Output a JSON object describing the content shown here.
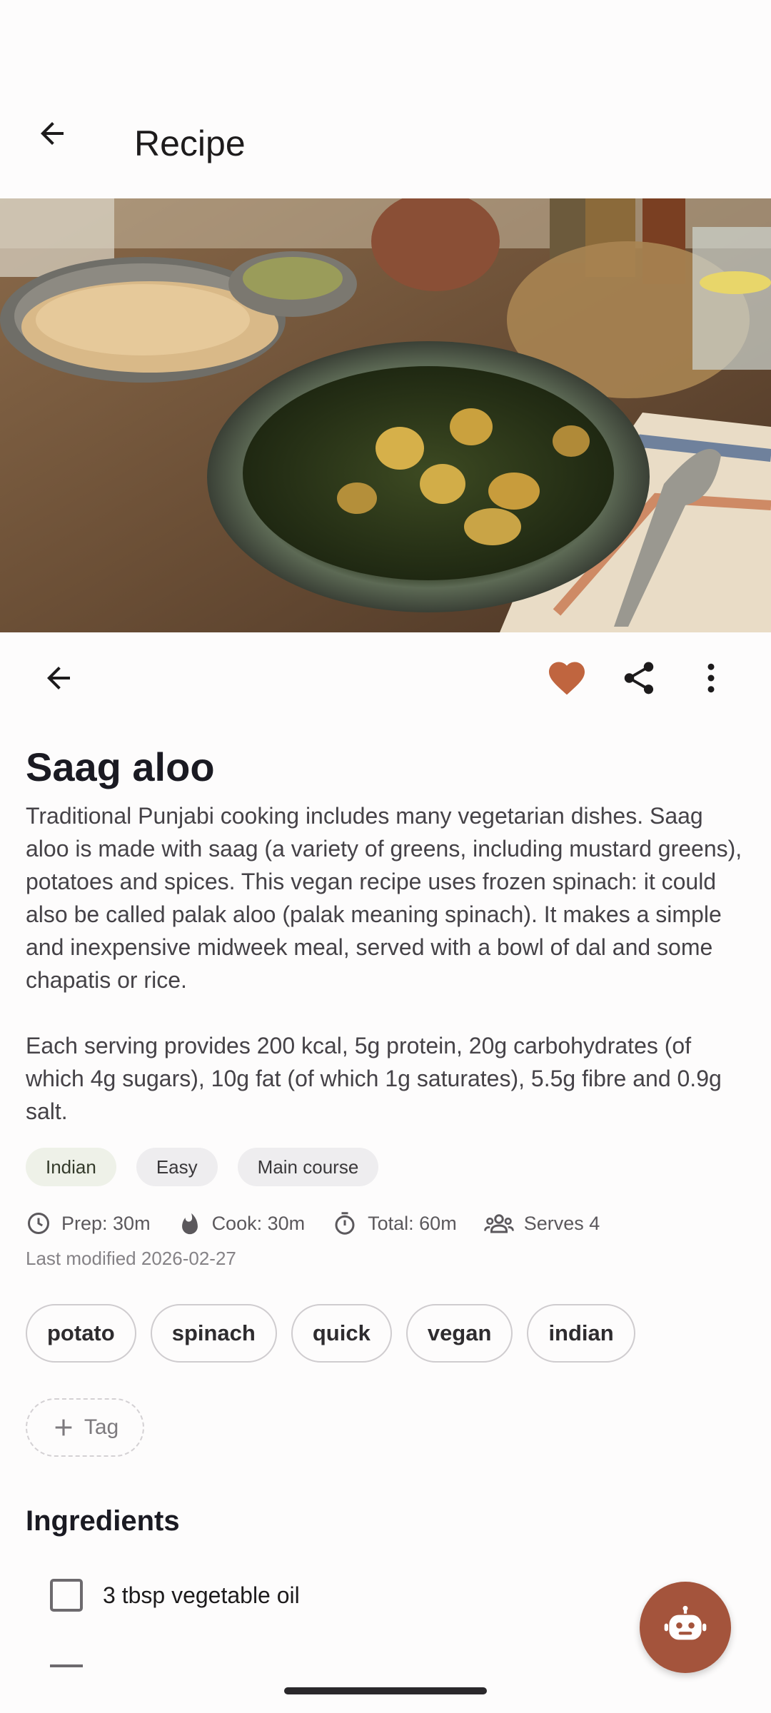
{
  "app_bar": {
    "title": "Recipe"
  },
  "hero": {
    "description_image": "saag-aloo-photo"
  },
  "actions": {
    "back_icon": "arrow-back-icon",
    "favorite_icon": "heart-icon",
    "favorite_color": "#c0653f",
    "share_icon": "share-icon",
    "more_icon": "more-vert-icon"
  },
  "recipe": {
    "title": "Saag aloo",
    "description": "Traditional Punjabi cooking includes many vegetarian dishes. Saag aloo is made with saag (a variety of greens, including mustard greens), potatoes and spices. This vegan recipe uses frozen spinach: it could also be called palak aloo (palak meaning spinach). It makes a simple and inexpensive midweek meal, served with a bowl of dal and some chapatis or rice.\n\nEach serving provides 200 kcal, 5g protein, 20g carbohydrates (of which 4g sugars), 10g fat (of which 1g saturates), 5.5g fibre and 0.9g salt.",
    "chips": [
      "Indian",
      "Easy",
      "Main course"
    ],
    "meta": {
      "prep": "Prep: 30m",
      "cook": "Cook: 30m",
      "total": "Total: 60m",
      "serves": "Serves 4"
    },
    "last_modified": "Last modified 2026-02-27",
    "tags": [
      "potato",
      "spinach",
      "quick",
      "vegan",
      "indian"
    ],
    "add_tag_label": "Tag"
  },
  "ingredients": {
    "title": "Ingredients",
    "items": [
      {
        "label": "3 tbsp vegetable oil",
        "checked": false
      }
    ]
  },
  "fab": {
    "icon": "robot-icon",
    "color": "#a4543c"
  }
}
